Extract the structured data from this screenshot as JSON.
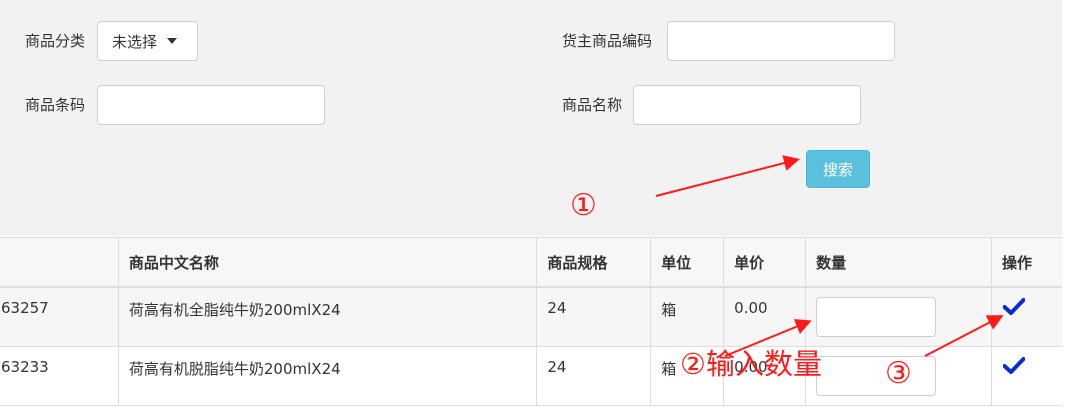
{
  "filters": {
    "category_label": "商品分类",
    "category_value": "未选择",
    "owner_code_label": "货主商品编码",
    "owner_code_value": "",
    "barcode_label": "商品条码",
    "barcode_value": "",
    "name_label": "商品名称",
    "name_value": "",
    "search_button": "搜索"
  },
  "table": {
    "headers": [
      "",
      "商品中文名称",
      "商品规格",
      "单位",
      "单价",
      "数量",
      "操作"
    ],
    "rows": [
      {
        "code": "63257",
        "name": "荷高有机全脂纯牛奶200mlX24",
        "spec": "24",
        "unit": "箱",
        "price": "0.00",
        "qty": ""
      },
      {
        "code": "63233",
        "name": "荷高有机脱脂纯牛奶200mlX24",
        "spec": "24",
        "unit": "箱",
        "price": "0.00",
        "qty": ""
      }
    ]
  },
  "annotations": {
    "step1": "①",
    "step2": "②输入数量",
    "step3": "③"
  },
  "colors": {
    "search_button": "#5bc0de",
    "annotation": "#ff1a1a",
    "check_icon": "#0a2ad8"
  }
}
